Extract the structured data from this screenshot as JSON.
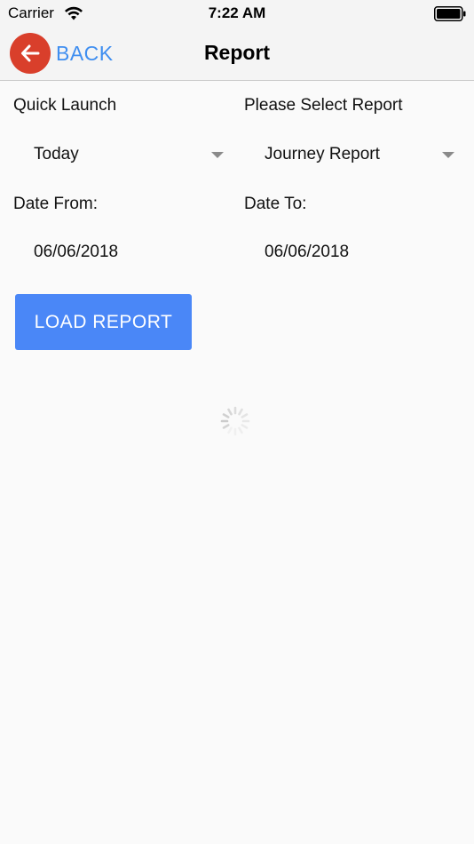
{
  "status_bar": {
    "carrier": "Carrier",
    "time": "7:22 AM"
  },
  "nav": {
    "back_label": "BACK",
    "title": "Report"
  },
  "form": {
    "quick_launch_label": "Quick Launch",
    "quick_launch_value": "Today",
    "report_label": "Please Select Report",
    "report_value": "Journey Report",
    "date_from_label": "Date From:",
    "date_from_value": "06/06/2018",
    "date_to_label": "Date To:",
    "date_to_value": "06/06/2018",
    "load_button_label": "LOAD REPORT"
  },
  "colors": {
    "accent": "#4a87f7",
    "back_circle": "#d93f2b",
    "back_text": "#3f8ef0"
  },
  "icons": {
    "back": "arrow-left-icon",
    "wifi": "wifi-icon",
    "battery": "battery-icon",
    "dropdown": "caret-down-icon",
    "loading": "spinner-icon"
  }
}
